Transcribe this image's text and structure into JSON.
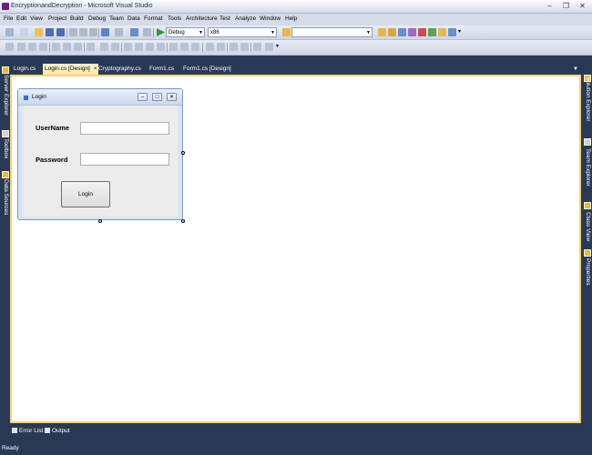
{
  "window": {
    "title": "EncryptionandDecryption - Microsoft Visual Studio",
    "minimize": "–",
    "restore": "❐",
    "close": "✕"
  },
  "menu": [
    "File",
    "Edit",
    "View",
    "Project",
    "Build",
    "Debug",
    "Team",
    "Data",
    "Format",
    "Tools",
    "Architecture",
    "Test",
    "Analyze",
    "Window",
    "Help"
  ],
  "toolbar": {
    "config_combo": "Debug",
    "platform_combo": "x86",
    "find_combo": ""
  },
  "tabs": [
    {
      "label": "Login.cs",
      "active": false
    },
    {
      "label": "Login.cs [Design]",
      "active": true,
      "close": "×"
    },
    {
      "label": "Cryptography.cs",
      "active": false
    },
    {
      "label": "Form1.cs",
      "active": false
    },
    {
      "label": "Form1.cs [Design]",
      "active": false
    }
  ],
  "left_panel": {
    "server_explorer": "Server Explorer",
    "toolbox": "Toolbox",
    "data_sources": "Data Sources"
  },
  "right_panel": {
    "solution_explorer": "Solution Explorer",
    "team_explorer": "Team Explorer",
    "class_view": "Class View",
    "properties": "Properties"
  },
  "form": {
    "title": "Login",
    "username_label": "UserName",
    "username_value": "",
    "password_label": "Password",
    "password_value": "",
    "login_button": "Login",
    "min": "–",
    "max": "□",
    "close": "✕"
  },
  "bottom_tabs": {
    "error_list": "Error List",
    "output": "Output"
  },
  "status": "Ready",
  "colors": {
    "chrome": "#293955",
    "editor_border": "#f5d17d",
    "active_tab": "#ffe8a6"
  }
}
